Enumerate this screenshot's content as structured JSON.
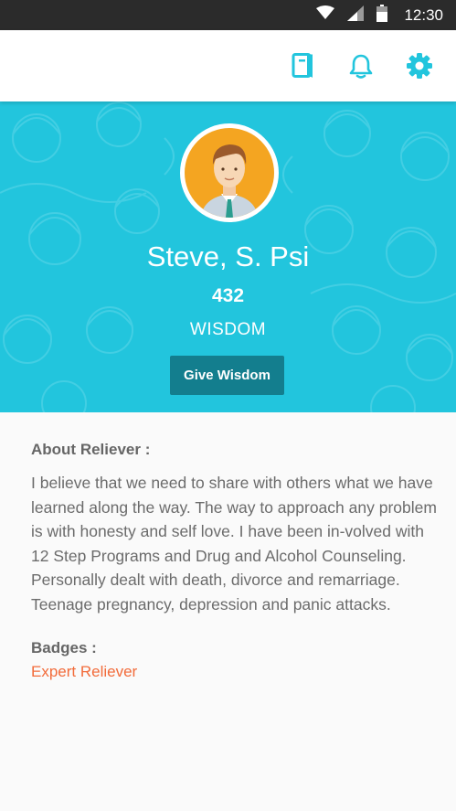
{
  "status_bar": {
    "time": "12:30"
  },
  "app_bar": {
    "icons": [
      "journal-icon",
      "bell-icon",
      "gear-icon"
    ],
    "accent_color": "#22c5dd"
  },
  "profile": {
    "name": "Steve, S. Psi",
    "wisdom_score": "432",
    "wisdom_label": "WISDOM",
    "give_button_label": "Give Wisdom"
  },
  "about": {
    "heading": "About Reliever :",
    "text": "I believe that we need to share with others what we have learned along the way. The way to approach any problem is with honesty and self love. I have been in-volved with 12 Step Programs and Drug and Alcohol Counseling. Personally dealt with death, divorce and remarriage. Teenage pregnancy, depression and panic attacks."
  },
  "badges": {
    "heading": "Badges :",
    "items": [
      "Expert Reliever"
    ],
    "badge_color": "#f26b3a"
  },
  "colors": {
    "hero_background": "#22c5dd",
    "button_background": "#137e8e",
    "status_bar": "#2b2b2b"
  }
}
